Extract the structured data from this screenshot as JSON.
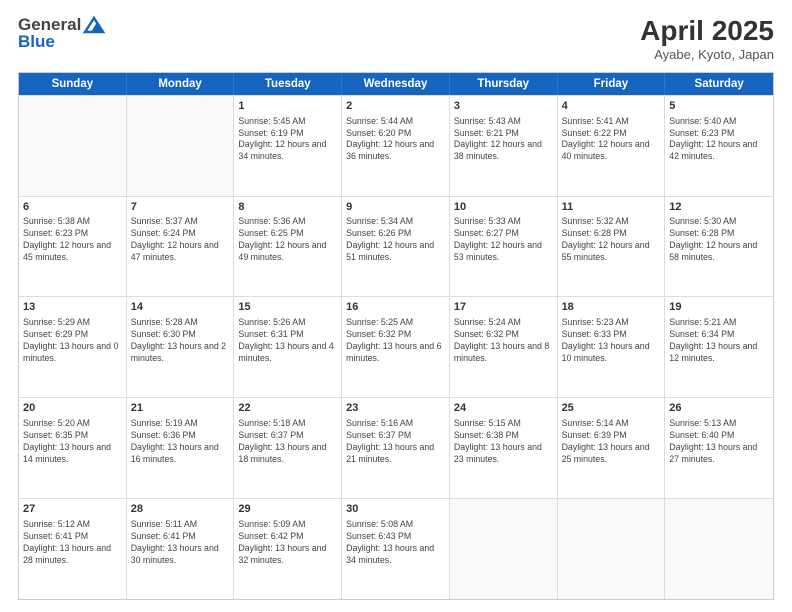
{
  "logo": {
    "general": "General",
    "blue": "Blue"
  },
  "title": "April 2025",
  "subtitle": "Ayabe, Kyoto, Japan",
  "headers": [
    "Sunday",
    "Monday",
    "Tuesday",
    "Wednesday",
    "Thursday",
    "Friday",
    "Saturday"
  ],
  "rows": [
    [
      {
        "day": "",
        "detail": ""
      },
      {
        "day": "",
        "detail": ""
      },
      {
        "day": "1",
        "detail": "Sunrise: 5:45 AM\nSunset: 6:19 PM\nDaylight: 12 hours and 34 minutes."
      },
      {
        "day": "2",
        "detail": "Sunrise: 5:44 AM\nSunset: 6:20 PM\nDaylight: 12 hours and 36 minutes."
      },
      {
        "day": "3",
        "detail": "Sunrise: 5:43 AM\nSunset: 6:21 PM\nDaylight: 12 hours and 38 minutes."
      },
      {
        "day": "4",
        "detail": "Sunrise: 5:41 AM\nSunset: 6:22 PM\nDaylight: 12 hours and 40 minutes."
      },
      {
        "day": "5",
        "detail": "Sunrise: 5:40 AM\nSunset: 6:23 PM\nDaylight: 12 hours and 42 minutes."
      }
    ],
    [
      {
        "day": "6",
        "detail": "Sunrise: 5:38 AM\nSunset: 6:23 PM\nDaylight: 12 hours and 45 minutes."
      },
      {
        "day": "7",
        "detail": "Sunrise: 5:37 AM\nSunset: 6:24 PM\nDaylight: 12 hours and 47 minutes."
      },
      {
        "day": "8",
        "detail": "Sunrise: 5:36 AM\nSunset: 6:25 PM\nDaylight: 12 hours and 49 minutes."
      },
      {
        "day": "9",
        "detail": "Sunrise: 5:34 AM\nSunset: 6:26 PM\nDaylight: 12 hours and 51 minutes."
      },
      {
        "day": "10",
        "detail": "Sunrise: 5:33 AM\nSunset: 6:27 PM\nDaylight: 12 hours and 53 minutes."
      },
      {
        "day": "11",
        "detail": "Sunrise: 5:32 AM\nSunset: 6:28 PM\nDaylight: 12 hours and 55 minutes."
      },
      {
        "day": "12",
        "detail": "Sunrise: 5:30 AM\nSunset: 6:28 PM\nDaylight: 12 hours and 58 minutes."
      }
    ],
    [
      {
        "day": "13",
        "detail": "Sunrise: 5:29 AM\nSunset: 6:29 PM\nDaylight: 13 hours and 0 minutes."
      },
      {
        "day": "14",
        "detail": "Sunrise: 5:28 AM\nSunset: 6:30 PM\nDaylight: 13 hours and 2 minutes."
      },
      {
        "day": "15",
        "detail": "Sunrise: 5:26 AM\nSunset: 6:31 PM\nDaylight: 13 hours and 4 minutes."
      },
      {
        "day": "16",
        "detail": "Sunrise: 5:25 AM\nSunset: 6:32 PM\nDaylight: 13 hours and 6 minutes."
      },
      {
        "day": "17",
        "detail": "Sunrise: 5:24 AM\nSunset: 6:32 PM\nDaylight: 13 hours and 8 minutes."
      },
      {
        "day": "18",
        "detail": "Sunrise: 5:23 AM\nSunset: 6:33 PM\nDaylight: 13 hours and 10 minutes."
      },
      {
        "day": "19",
        "detail": "Sunrise: 5:21 AM\nSunset: 6:34 PM\nDaylight: 13 hours and 12 minutes."
      }
    ],
    [
      {
        "day": "20",
        "detail": "Sunrise: 5:20 AM\nSunset: 6:35 PM\nDaylight: 13 hours and 14 minutes."
      },
      {
        "day": "21",
        "detail": "Sunrise: 5:19 AM\nSunset: 6:36 PM\nDaylight: 13 hours and 16 minutes."
      },
      {
        "day": "22",
        "detail": "Sunrise: 5:18 AM\nSunset: 6:37 PM\nDaylight: 13 hours and 18 minutes."
      },
      {
        "day": "23",
        "detail": "Sunrise: 5:16 AM\nSunset: 6:37 PM\nDaylight: 13 hours and 21 minutes."
      },
      {
        "day": "24",
        "detail": "Sunrise: 5:15 AM\nSunset: 6:38 PM\nDaylight: 13 hours and 23 minutes."
      },
      {
        "day": "25",
        "detail": "Sunrise: 5:14 AM\nSunset: 6:39 PM\nDaylight: 13 hours and 25 minutes."
      },
      {
        "day": "26",
        "detail": "Sunrise: 5:13 AM\nSunset: 6:40 PM\nDaylight: 13 hours and 27 minutes."
      }
    ],
    [
      {
        "day": "27",
        "detail": "Sunrise: 5:12 AM\nSunset: 6:41 PM\nDaylight: 13 hours and 28 minutes."
      },
      {
        "day": "28",
        "detail": "Sunrise: 5:11 AM\nSunset: 6:41 PM\nDaylight: 13 hours and 30 minutes."
      },
      {
        "day": "29",
        "detail": "Sunrise: 5:09 AM\nSunset: 6:42 PM\nDaylight: 13 hours and 32 minutes."
      },
      {
        "day": "30",
        "detail": "Sunrise: 5:08 AM\nSunset: 6:43 PM\nDaylight: 13 hours and 34 minutes."
      },
      {
        "day": "",
        "detail": ""
      },
      {
        "day": "",
        "detail": ""
      },
      {
        "day": "",
        "detail": ""
      }
    ]
  ]
}
